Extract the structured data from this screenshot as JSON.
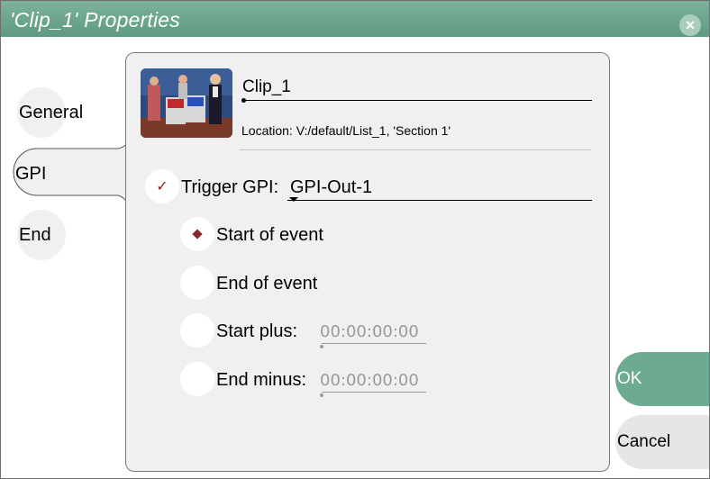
{
  "window": {
    "title": "'Clip_1' Properties",
    "close_glyph": "×"
  },
  "tabs": [
    {
      "label": "General",
      "selected": false
    },
    {
      "label": "GPI",
      "selected": true
    },
    {
      "label": "End",
      "selected": false
    }
  ],
  "clip": {
    "name": "Clip_1",
    "location": "Location: V:/default/List_1, 'Section 1'"
  },
  "gpi": {
    "trigger_label": "Trigger GPI:",
    "trigger_value": "GPI-Out-1",
    "trigger_checked": true,
    "check_glyph": "✓",
    "options": [
      {
        "label": "Start of event",
        "selected": true
      },
      {
        "label": "End of event",
        "selected": false
      },
      {
        "label": "Start plus:",
        "selected": false,
        "timecode": "00:00:00:00"
      },
      {
        "label": "End minus:",
        "selected": false,
        "timecode": "00:00:00:00"
      }
    ]
  },
  "buttons": {
    "ok": "OK",
    "cancel": "Cancel"
  },
  "colors": {
    "accent": "#6dab90",
    "titlebar": "#6aa58a",
    "panel": "#f0f0f0",
    "radio_mark": "#8c2a2a"
  }
}
